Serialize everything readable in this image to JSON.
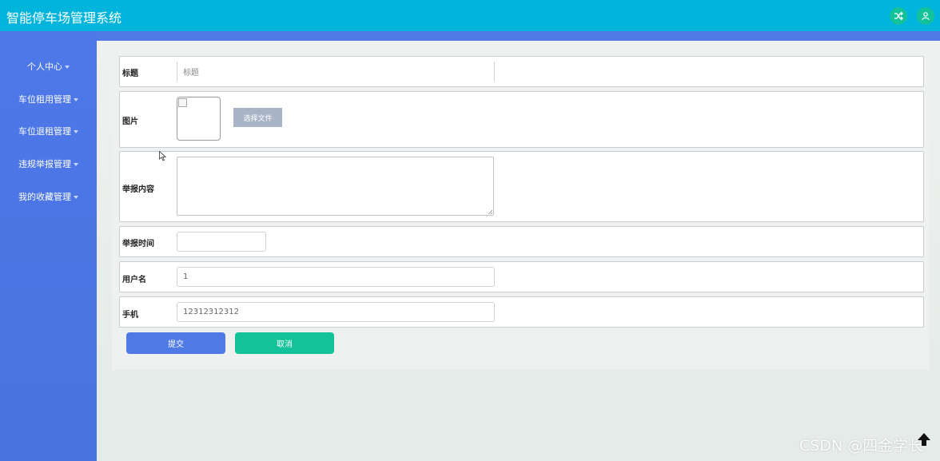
{
  "header": {
    "title": "智能停车场管理系统",
    "shuffle_icon": "shuffle-icon",
    "user_icon": "user-icon"
  },
  "sidebar": {
    "items": [
      {
        "label": "个人中心"
      },
      {
        "label": "车位租用管理"
      },
      {
        "label": "车位退租管理"
      },
      {
        "label": "违规举报管理"
      },
      {
        "label": "我的收藏管理"
      }
    ]
  },
  "form": {
    "title": {
      "label": "标题",
      "placeholder": "标题"
    },
    "image": {
      "label": "图片",
      "choose_file": "选择文件"
    },
    "content": {
      "label": "举报内容"
    },
    "report_time": {
      "label": "举报时间",
      "value": ""
    },
    "username": {
      "label": "用户名",
      "value": "1"
    },
    "phone": {
      "label": "手机",
      "value": "12312312312"
    }
  },
  "actions": {
    "submit": "提交",
    "cancel": "取消"
  },
  "watermark": "CSDN @四金学长",
  "colors": {
    "header": "#00b4dc",
    "sidebar": "#4e78e8",
    "primary_button": "#4f7ae6",
    "success_button": "#14c29a"
  }
}
